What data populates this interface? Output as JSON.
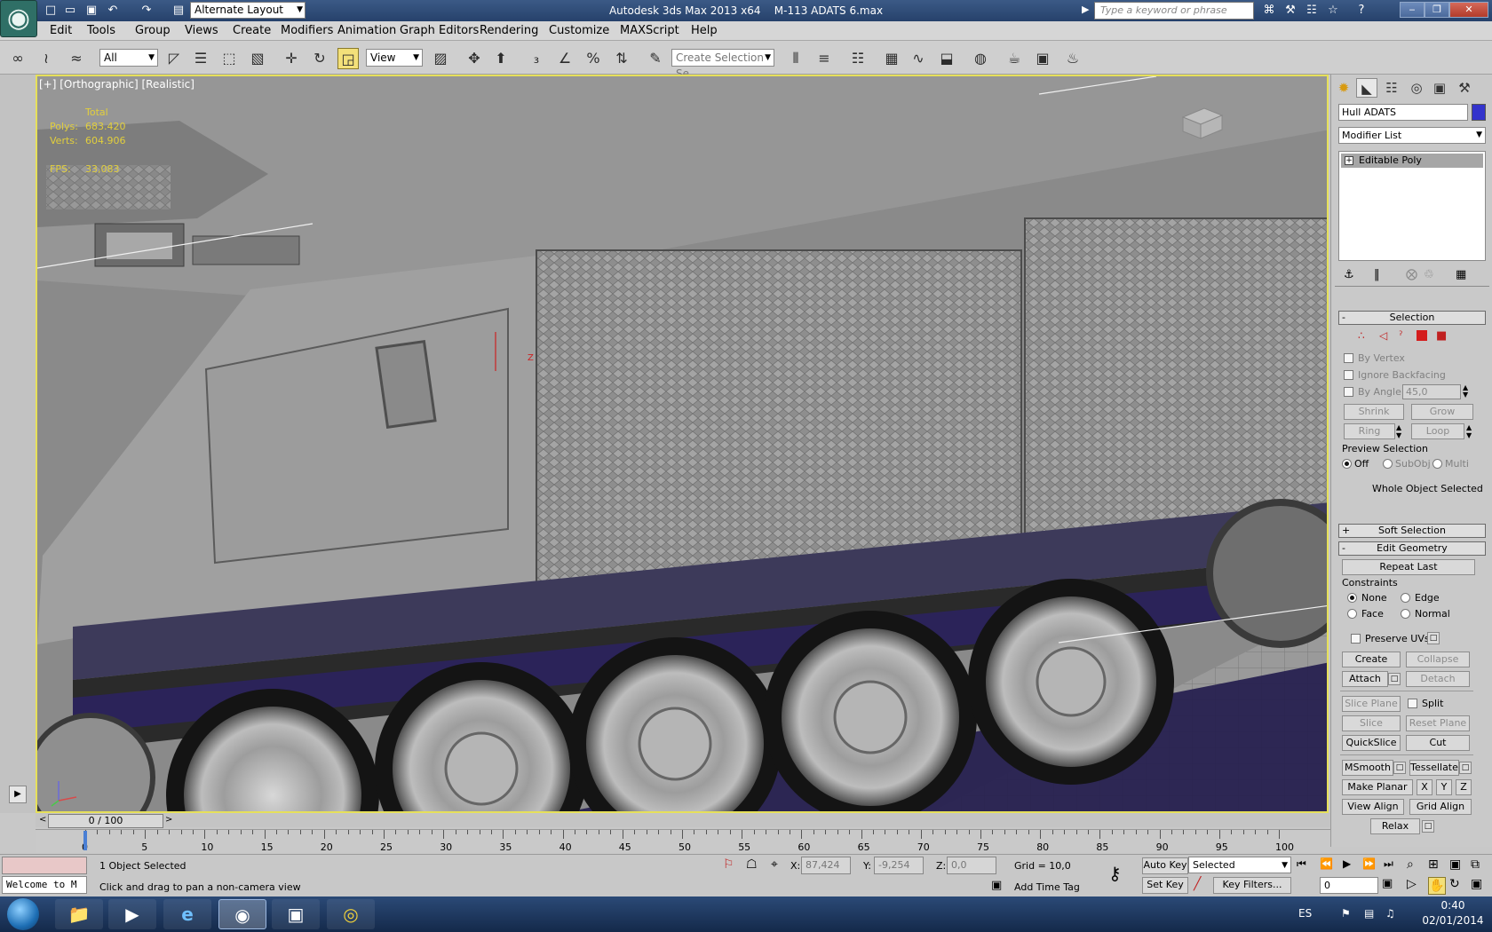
{
  "title": {
    "app": "Autodesk 3ds Max  2013 x64",
    "file": "M-113 ADATS 6.max",
    "layout": "Alternate Layout",
    "search_placeholder": "Type a keyword or phrase"
  },
  "menu": [
    "Edit",
    "Tools",
    "Group",
    "Views",
    "Create",
    "Modifiers",
    "Animation",
    "Graph Editors",
    "Rendering",
    "Customize",
    "MAXScript",
    "Help"
  ],
  "toolbar": {
    "filter": "All",
    "refcoord": "View",
    "selection_set_placeholder": "Create Selection Se"
  },
  "viewport": {
    "label": "[+] [Orthographic] [Realistic]",
    "stats": {
      "header": "Total",
      "polys_label": "Polys:",
      "polys": "683.420",
      "verts_label": "Verts:",
      "verts": "604.906",
      "fps_label": "FPS:",
      "fps": "33,083"
    },
    "gizmo_axis": "Z"
  },
  "panel": {
    "object_name": "Hull ADATS",
    "object_color": "#3333cc",
    "modifier_list": "Modifier List",
    "stack_item": "Editable Poly",
    "selection": {
      "title": "Selection",
      "by_vertex": "By Vertex",
      "ignore_backfacing": "Ignore Backfacing",
      "by_angle": "By Angle:",
      "angle": "45,0",
      "shrink": "Shrink",
      "grow": "Grow",
      "ring": "Ring",
      "loop": "Loop",
      "preview": "Preview Selection",
      "off": "Off",
      "subobj": "SubObj",
      "multi": "Multi",
      "status": "Whole Object Selected"
    },
    "soft_selection": "Soft Selection",
    "edit_geometry": {
      "title": "Edit Geometry",
      "repeat_last": "Repeat Last",
      "constraints": "Constraints",
      "none": "None",
      "edge": "Edge",
      "face": "Face",
      "normal": "Normal",
      "preserve_uvs": "Preserve UVs",
      "create": "Create",
      "collapse": "Collapse",
      "attach": "Attach",
      "detach": "Detach",
      "slice_plane": "Slice Plane",
      "split": "Split",
      "slice": "Slice",
      "reset_plane": "Reset Plane",
      "quickslice": "QuickSlice",
      "cut": "Cut",
      "msmooth": "MSmooth",
      "tessellate": "Tessellate",
      "make_planar": "Make Planar",
      "x": "X",
      "y": "Y",
      "z": "Z",
      "view_align": "View Align",
      "grid_align": "Grid Align",
      "relax": "Relax"
    }
  },
  "timeline": {
    "slider": "0 / 100",
    "ticks": [
      "0",
      "5",
      "10",
      "15",
      "20",
      "25",
      "30",
      "35",
      "40",
      "45",
      "50",
      "55",
      "60",
      "65",
      "70",
      "75",
      "80",
      "85",
      "90",
      "95",
      "100"
    ]
  },
  "status": {
    "selected": "1 Object Selected",
    "prompt": "Click and drag to pan a non-camera view",
    "listener": "Welcome to M",
    "x_label": "X:",
    "x": "87,424",
    "y_label": "Y:",
    "y": "-9,254",
    "z_label": "Z:",
    "z": "0,0",
    "grid": "Grid = 10,0",
    "add_time_tag": "Add Time Tag",
    "auto_key": "Auto Key",
    "set_key": "Set Key",
    "key_mode": "Selected",
    "key_filters": "Key Filters...",
    "frame": "0"
  },
  "taskbar": {
    "lang": "ES",
    "time": "0:40",
    "date": "02/01/2014"
  }
}
